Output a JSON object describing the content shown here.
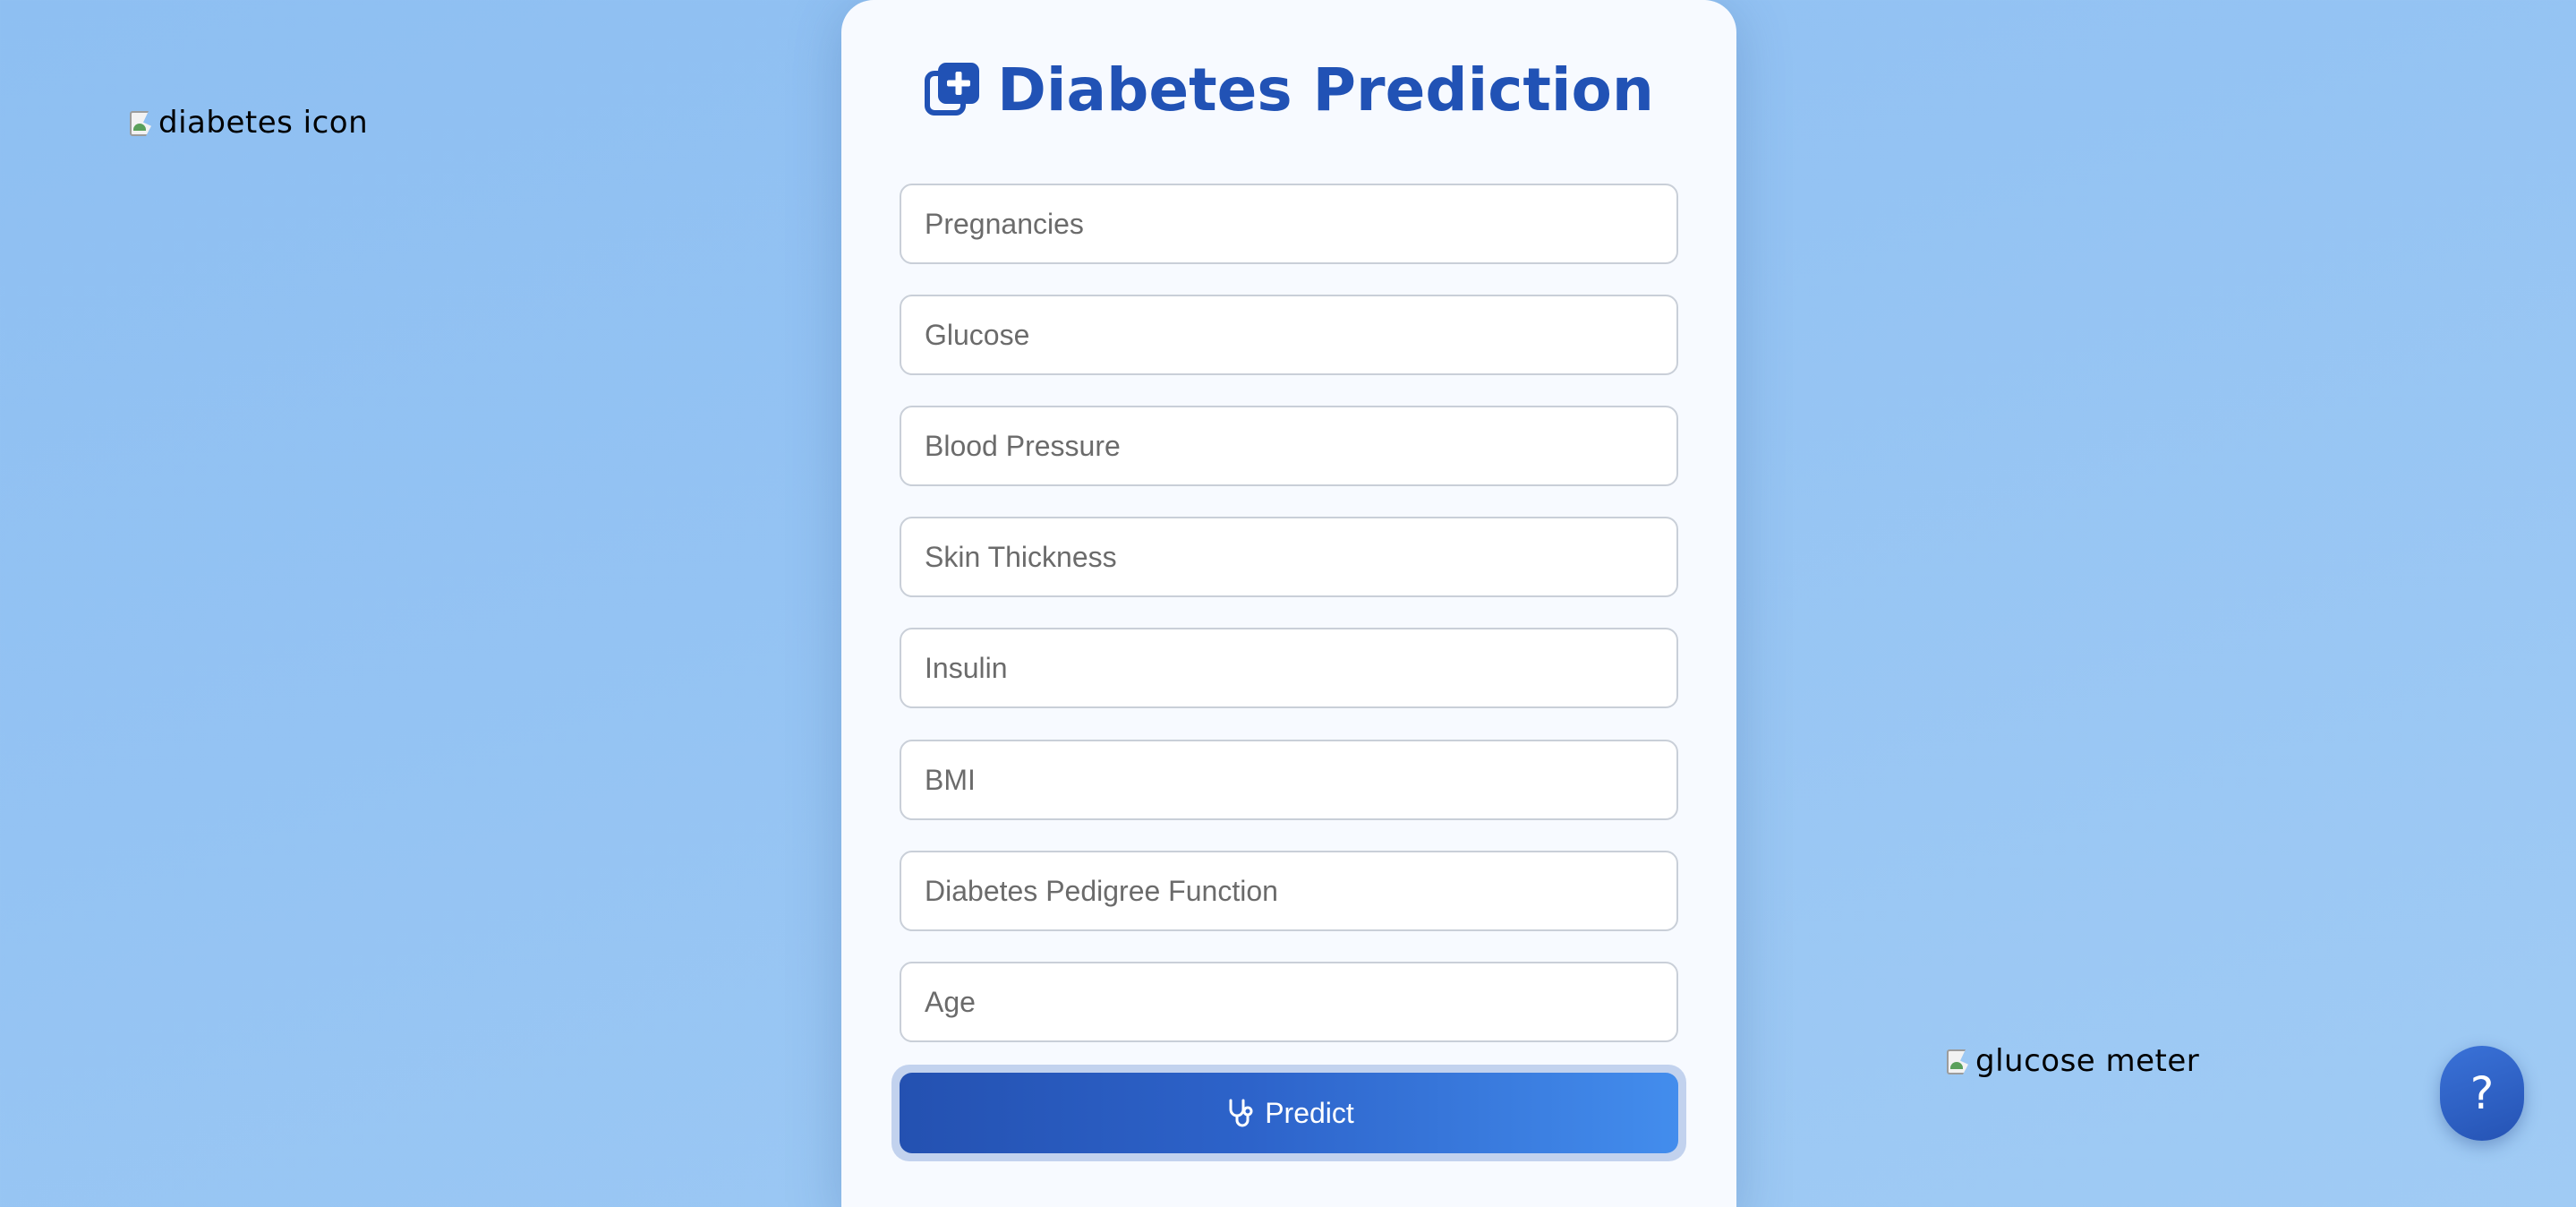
{
  "images": {
    "top_left_alt": "diabetes icon",
    "bottom_right_alt": "glucose meter"
  },
  "form": {
    "title": "Diabetes Prediction",
    "title_icon": "medical-plus-icon",
    "fields": [
      {
        "placeholder": "Pregnancies",
        "value": ""
      },
      {
        "placeholder": "Glucose",
        "value": ""
      },
      {
        "placeholder": "Blood Pressure",
        "value": ""
      },
      {
        "placeholder": "Skin Thickness",
        "value": ""
      },
      {
        "placeholder": "Insulin",
        "value": ""
      },
      {
        "placeholder": "BMI",
        "value": ""
      },
      {
        "placeholder": "Diabetes Pedigree Function",
        "value": ""
      },
      {
        "placeholder": "Age",
        "value": ""
      }
    ],
    "submit_label": "Predict",
    "submit_icon": "stethoscope-icon"
  },
  "help": {
    "label": "?"
  },
  "colors": {
    "accent": "#2152b5",
    "background": "#94c3f3",
    "card": "#f7faff"
  }
}
